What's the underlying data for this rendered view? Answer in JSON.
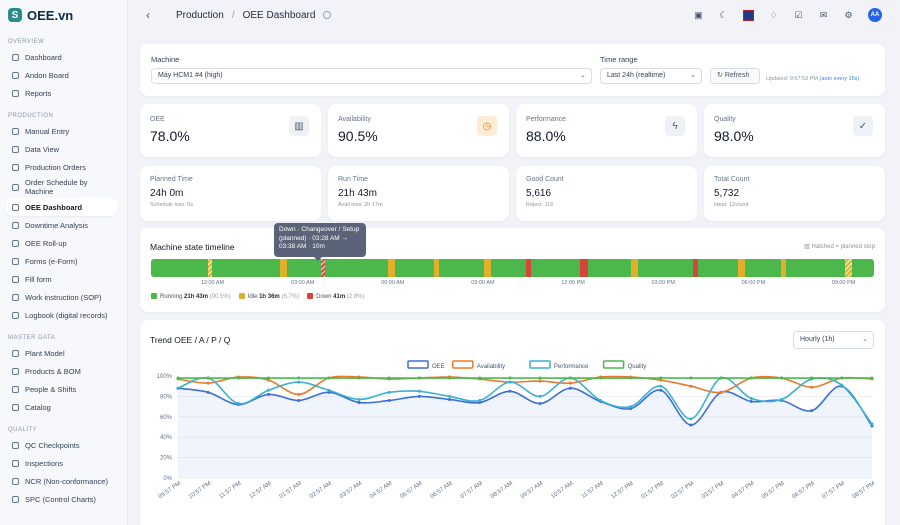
{
  "app": {
    "name": "OEE.vn"
  },
  "sidebar": {
    "sections": [
      {
        "title": "OVERVIEW",
        "items": [
          "Dashboard",
          "Andon Board",
          "Reports"
        ]
      },
      {
        "title": "PRODUCTION",
        "items": [
          "Manual Entry",
          "Data View",
          "Production Orders",
          "Order Schedule by Machine",
          "OEE Dashboard",
          "Downtime Analysis",
          "OEE Roll-up",
          "Forms (e-Form)",
          "Fill form",
          "Work instruction (SOP)",
          "Logbook (digital records)"
        ]
      },
      {
        "title": "MASTER DATA",
        "items": [
          "Plant Model",
          "Products & BOM",
          "People & Shifts",
          "Catalog"
        ]
      },
      {
        "title": "QUALITY",
        "items": [
          "QC Checkpoints",
          "Inspections",
          "NCR (Non-conformance)",
          "SPC (Control Charts)"
        ]
      }
    ],
    "active": "OEE Dashboard"
  },
  "header": {
    "crumb1": "Production",
    "sep": "/",
    "crumb2": "OEE Dashboard",
    "avatar": "AA"
  },
  "filters": {
    "machine_label": "Machine",
    "machine_value": "Máy HCM1 #4 (high)",
    "range_label": "Time range",
    "range_value": "Last 24h (realtime)",
    "refresh": "Refresh",
    "updated_prefix": "Updated: 9:57:53 PM",
    "updated_suffix": "(auto every 15s)"
  },
  "kpis": [
    {
      "label": "OEE",
      "value": "78.0%",
      "icon": "bar-chart-icon"
    },
    {
      "label": "Availability",
      "value": "90.5%",
      "icon": "clock-icon"
    },
    {
      "label": "Performance",
      "value": "88.0%",
      "icon": "bolt-icon"
    },
    {
      "label": "Quality",
      "value": "98.0%",
      "icon": "check-circle-icon"
    }
  ],
  "stats": [
    {
      "label": "Planned Time",
      "value": "24h 0m",
      "sub": "Schedule loss: 0s"
    },
    {
      "label": "Run Time",
      "value": "21h 43m",
      "sub": "Avail loss: 2h 17m"
    },
    {
      "label": "Good Count",
      "value": "5,616",
      "sub": "Reject: 116"
    },
    {
      "label": "Total Count",
      "value": "5,732",
      "sub": "Ideal: 12s/unit"
    }
  ],
  "timeline": {
    "title": "Machine state timeline",
    "hatch_note": "Hatched = planned stop",
    "tooltip": "Down · Changeover / Setup (planned) · 03:28 AM → 03:38 AM · 10m",
    "ticks": [
      "12:00 AM",
      "03:00 AM",
      "06:00 AM",
      "09:00 AM",
      "12:00 PM",
      "03:00 PM",
      "06:00 PM",
      "09:00 PM"
    ],
    "legend": [
      {
        "name": "Running",
        "value": "21h 43m",
        "pct": "(90.5%)",
        "color": "#4cb84c"
      },
      {
        "name": "Idle",
        "value": "1h 36m",
        "pct": "(6.7%)",
        "color": "#e0b128"
      },
      {
        "name": "Down",
        "value": "41m",
        "pct": "(2.8%)",
        "color": "#d9443a"
      }
    ],
    "segments": [
      {
        "start": 0.079,
        "w": 0.006,
        "state": "idle",
        "planned": true
      },
      {
        "start": 0.179,
        "w": 0.009,
        "state": "idle"
      },
      {
        "start": 0.235,
        "w": 0.006,
        "state": "down",
        "planned": true
      },
      {
        "start": 0.328,
        "w": 0.009,
        "state": "idle"
      },
      {
        "start": 0.391,
        "w": 0.008,
        "state": "idle"
      },
      {
        "start": 0.461,
        "w": 0.009,
        "state": "idle"
      },
      {
        "start": 0.519,
        "w": 0.006,
        "state": "down"
      },
      {
        "start": 0.593,
        "w": 0.011,
        "state": "down"
      },
      {
        "start": 0.664,
        "w": 0.009,
        "state": "idle"
      },
      {
        "start": 0.749,
        "w": 0.008,
        "state": "down"
      },
      {
        "start": 0.812,
        "w": 0.009,
        "state": "idle"
      },
      {
        "start": 0.871,
        "w": 0.007,
        "state": "idle"
      },
      {
        "start": 0.96,
        "w": 0.009,
        "state": "idle",
        "planned": true
      }
    ]
  },
  "trend": {
    "title": "Trend OEE / A / P / Q",
    "granularity": "Hourly (1h)"
  },
  "colors": {
    "oee": "#3b6fd6",
    "availability": "#ea7a2f",
    "performance": "#3ab1cf",
    "quality": "#4cb84c"
  },
  "chart_data": {
    "type": "line",
    "categories": [
      "09:57 PM",
      "10:57 PM",
      "11:57 PM",
      "12:57 AM",
      "01:57 AM",
      "02:57 AM",
      "03:57 AM",
      "04:57 AM",
      "05:57 AM",
      "06:57 AM",
      "07:57 AM",
      "08:57 AM",
      "09:57 AM",
      "10:57 AM",
      "11:57 AM",
      "12:57 PM",
      "01:57 PM",
      "02:57 PM",
      "03:57 PM",
      "04:57 PM",
      "05:57 PM",
      "06:57 PM",
      "07:57 PM",
      "08:57 PM"
    ],
    "series": [
      {
        "name": "OEE",
        "values": [
          88,
          84,
          72,
          82,
          76,
          84,
          74,
          76,
          80,
          77,
          74,
          85,
          73,
          88,
          75,
          68,
          86,
          52,
          84,
          75,
          76,
          66,
          90,
          51
        ]
      },
      {
        "name": "Availability",
        "values": [
          97,
          93,
          99,
          96,
          82,
          98,
          99,
          97,
          98,
          99,
          97,
          94,
          95,
          93,
          99,
          99,
          96,
          90,
          84,
          98,
          98,
          89,
          98,
          97
        ]
      },
      {
        "name": "Performance",
        "values": [
          88,
          98,
          73,
          86,
          94,
          86,
          77,
          84,
          85,
          80,
          76,
          94,
          80,
          98,
          76,
          70,
          90,
          58,
          98,
          78,
          77,
          97,
          91,
          53
        ]
      },
      {
        "name": "Quality",
        "values": [
          98,
          98,
          98,
          98,
          98,
          98,
          98,
          98,
          98,
          98,
          98,
          98,
          98,
          98,
          98,
          98,
          98,
          98,
          98,
          98,
          98,
          98,
          98,
          98
        ]
      }
    ],
    "yticks": [
      "0%",
      "20%",
      "40%",
      "60%",
      "80%",
      "100%"
    ],
    "ylim": [
      0,
      100
    ],
    "legend_position": "top-center"
  }
}
